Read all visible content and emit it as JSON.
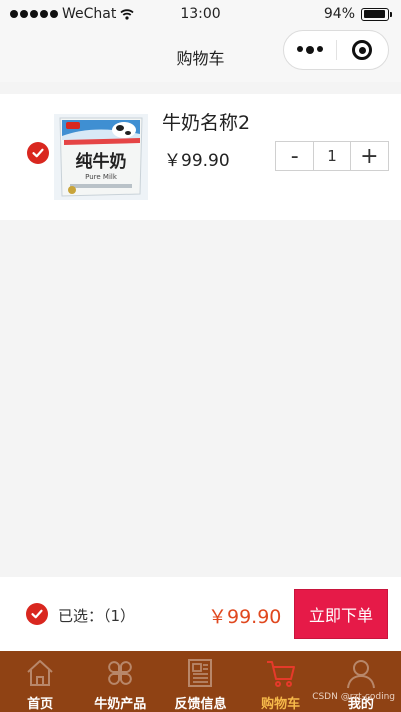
{
  "status_bar": {
    "carrier": "WeChat",
    "time": "13:00",
    "battery": "94%",
    "battery_level": 0.94
  },
  "navbar": {
    "title": "购物车"
  },
  "cart": {
    "items": [
      {
        "name": "牛奶名称2",
        "price": "￥99.90",
        "quantity": "1",
        "checked": true,
        "image_text": {
          "brand": "纯牛奶",
          "sub": "Pure Milk"
        }
      }
    ],
    "minus_label": "-",
    "plus_label": "+"
  },
  "settle": {
    "selected_text": "已选：（1）",
    "total": "￥99.90",
    "order_button": "立即下单"
  },
  "tabbar": {
    "items": [
      {
        "label": "首页",
        "icon": "home-icon"
      },
      {
        "label": "牛奶产品",
        "icon": "clover-icon"
      },
      {
        "label": "反馈信息",
        "icon": "document-icon"
      },
      {
        "label": "购物车",
        "icon": "cart-icon",
        "active": true
      },
      {
        "label": "我的",
        "icon": "user-icon"
      }
    ]
  },
  "watermark": "CSDN @rzt-coding",
  "colors": {
    "accent_red": "#d9271f",
    "price_orange": "#e0481f",
    "order_button": "#e61a48",
    "tabbar_bg": "#8f4214",
    "tab_active": "#f6b94a"
  }
}
